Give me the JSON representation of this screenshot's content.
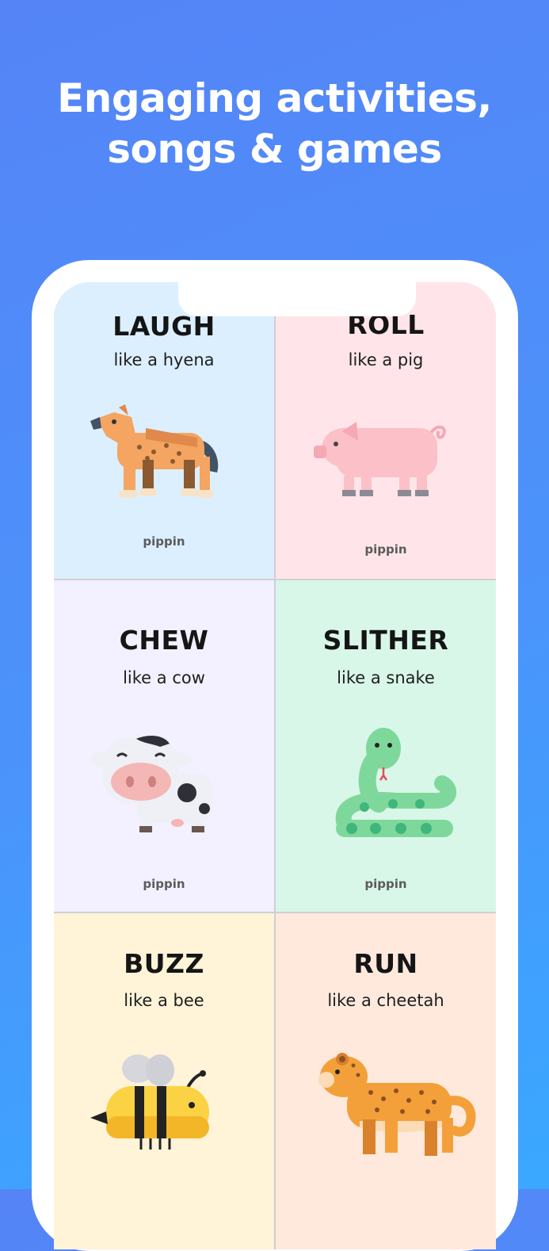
{
  "headline": {
    "line1": "Engaging activities,",
    "line2": "songs & games"
  },
  "cards": [
    {
      "verb": "LAUGH",
      "like": "like a hyena",
      "brand": "pippin",
      "icon": "hyena-icon",
      "bg": "#dcefff"
    },
    {
      "verb": "ROLL",
      "like": "like a pig",
      "brand": "pippin",
      "icon": "pig-icon",
      "bg": "#ffe5e9"
    },
    {
      "verb": "CHEW",
      "like": "like a cow",
      "brand": "pippin",
      "icon": "cow-icon",
      "bg": "#f3f0ff"
    },
    {
      "verb": "SLITHER",
      "like": "like a snake",
      "brand": "pippin",
      "icon": "snake-icon",
      "bg": "#d8f7e9"
    },
    {
      "verb": "BUZZ",
      "like": "like a bee",
      "icon": "bee-icon",
      "bg": "#fff3d8"
    },
    {
      "verb": "RUN",
      "like": "like a cheetah",
      "icon": "cheetah-icon",
      "bg": "#ffe9dd"
    }
  ]
}
